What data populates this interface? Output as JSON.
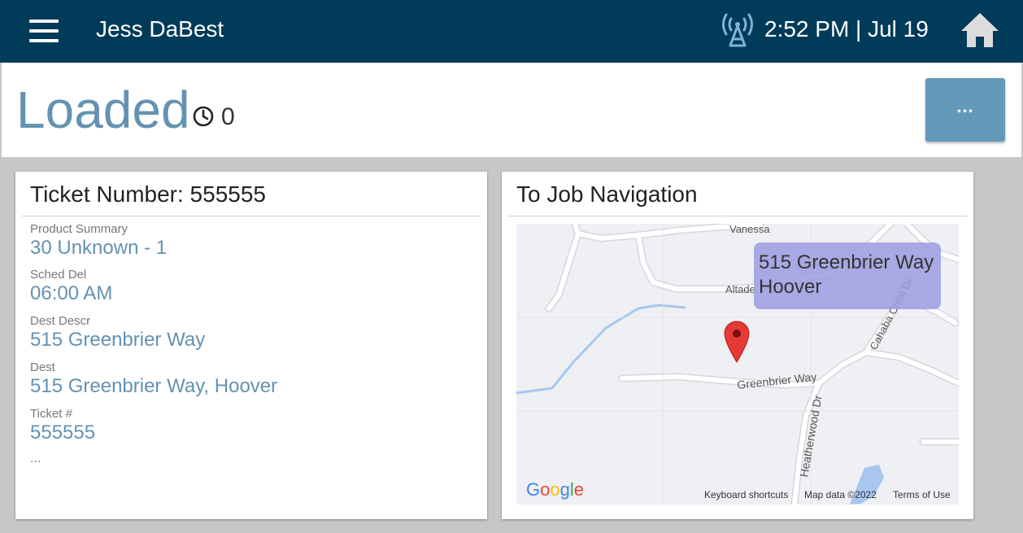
{
  "header": {
    "user_name": "Jess DaBest",
    "time_date": "2:52 PM | Jul 19",
    "icons": {
      "menu": "hamburger-menu-icon",
      "signal": "signal-tower-icon",
      "home": "home-icon"
    }
  },
  "status": {
    "title": "Loaded",
    "timer_icon": "clock-icon",
    "timer_count": "0",
    "more_label": "..."
  },
  "ticket_card": {
    "title": "Ticket Number: 555555",
    "fields": [
      {
        "label": "Product Summary",
        "value": "30 Unknown - 1"
      },
      {
        "label": "Sched Del",
        "value": "06:00 AM"
      },
      {
        "label": "Dest Descr",
        "value": "515 Greenbrier Way"
      },
      {
        "label": "Dest",
        "value": "515 Greenbrier Way, Hoover"
      },
      {
        "label": "Ticket #",
        "value": "555555"
      }
    ],
    "more": "..."
  },
  "nav_card": {
    "title": "To Job Navigation",
    "map": {
      "address_line1": "515 Greenbrier Way",
      "address_line2": "Hoover",
      "street_labels": {
        "vanessa": "Vanessa",
        "altadena": "Altade",
        "cahaba": "Cahaba Crest Dr",
        "greenbrier": "Greenbrier Way",
        "heatherwood": "Heatherwood Dr"
      },
      "logo_text": "Google",
      "keyboard_shortcuts": "Keyboard shortcuts",
      "map_data": "Map data ©2022",
      "terms": "Terms of Use"
    }
  },
  "colors": {
    "header_bg": "#003b5a",
    "accent": "#6492b2",
    "button": "#6599ba",
    "page_bg": "#c9c6c6"
  }
}
